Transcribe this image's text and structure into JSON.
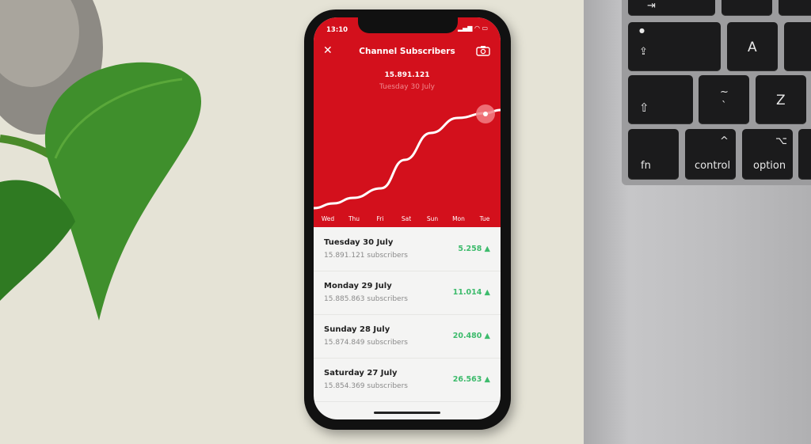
{
  "status_bar": {
    "time": "13:10"
  },
  "header": {
    "title": "Channel Subscribers",
    "close_icon": "close-icon",
    "camera_icon": "camera-icon"
  },
  "summary": {
    "value": "15.891.121",
    "date": "Tuesday 30 July"
  },
  "chart_data": {
    "type": "line",
    "categories": [
      "Wed",
      "Thu",
      "Fri",
      "Sat",
      "Sun",
      "Mon",
      "Tue"
    ],
    "values": [
      null,
      null,
      null,
      15854369,
      15874849,
      15885863,
      15891121
    ],
    "line_color": "#ffffff",
    "background": "#d3101c",
    "grid": false,
    "selected": "Tue"
  },
  "list": [
    {
      "date": "Tuesday 30 July",
      "subs": "15.891.121 subscribers",
      "change": "5.258 ▲"
    },
    {
      "date": "Monday 29 July",
      "subs": "15.885.863 subscribers",
      "change": "11.014 ▲"
    },
    {
      "date": "Sunday 28 July",
      "subs": "15.874.849 subscribers",
      "change": "20.480 ▲"
    },
    {
      "date": "Saturday 27 July",
      "subs": "15.854.369 subscribers",
      "change": "26.563 ▲"
    }
  ],
  "keyboard": {
    "a": "A",
    "tilde": "~",
    "backtick": "`",
    "z": "Z",
    "fn": "fn",
    "control": "control",
    "option": "option",
    "caret": "^",
    "option_symbol": "⌥"
  },
  "colors": {
    "accent": "#d3101c",
    "positive": "#3dbb6c"
  }
}
